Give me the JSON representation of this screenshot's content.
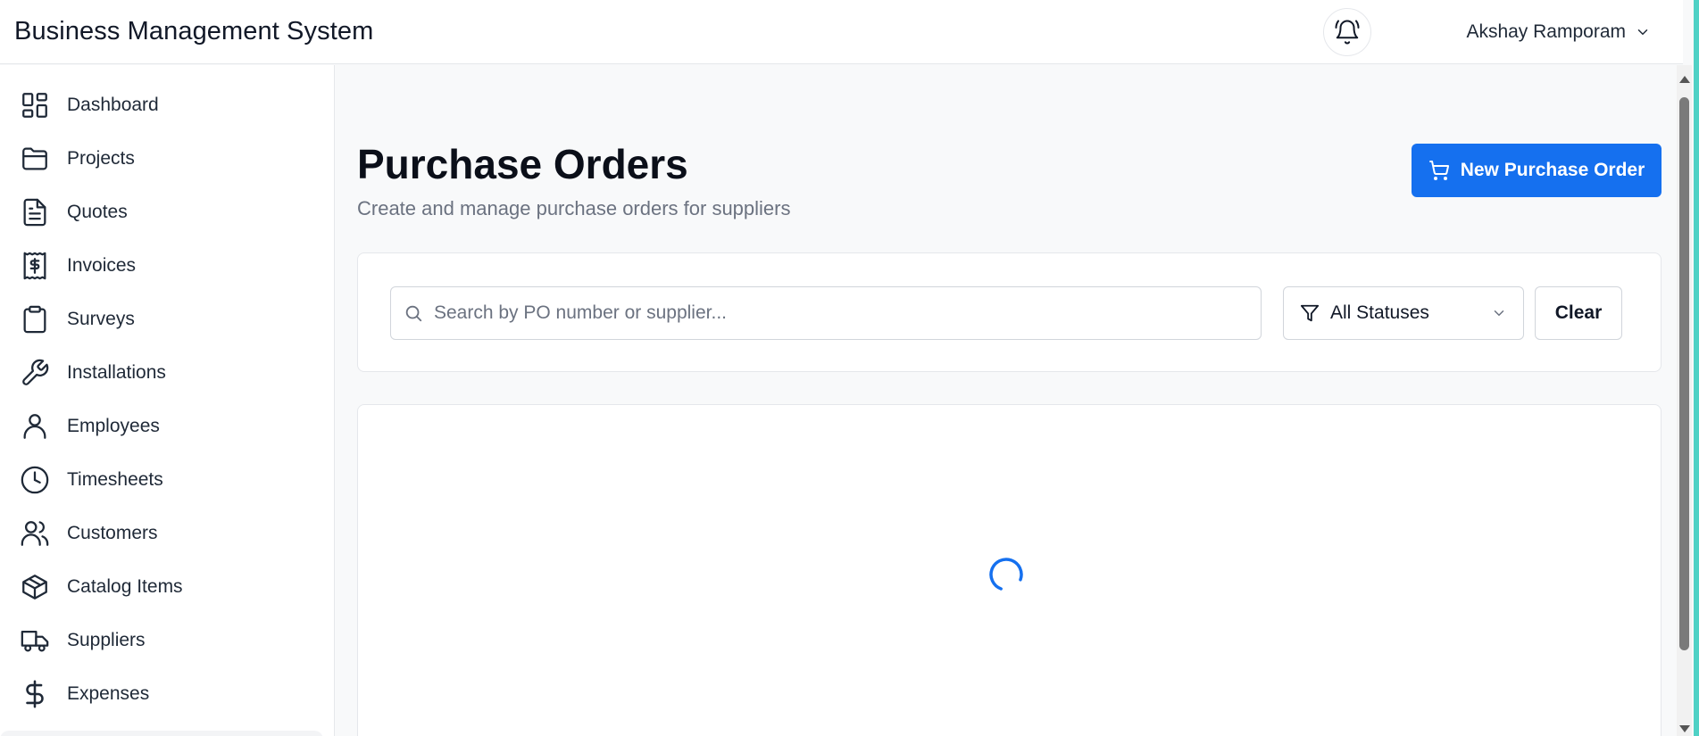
{
  "app": {
    "title": "Business Management System"
  },
  "header": {
    "user_name": "Akshay Ramporam",
    "bell_icon": "bell-ring-icon"
  },
  "sidebar": {
    "items": [
      {
        "label": "Dashboard",
        "icon": "dashboard-icon"
      },
      {
        "label": "Projects",
        "icon": "folder-icon"
      },
      {
        "label": "Quotes",
        "icon": "document-icon"
      },
      {
        "label": "Invoices",
        "icon": "receipt-icon"
      },
      {
        "label": "Surveys",
        "icon": "clipboard-icon"
      },
      {
        "label": "Installations",
        "icon": "wrench-icon"
      },
      {
        "label": "Employees",
        "icon": "user-icon"
      },
      {
        "label": "Timesheets",
        "icon": "clock-icon"
      },
      {
        "label": "Customers",
        "icon": "users-icon"
      },
      {
        "label": "Catalog Items",
        "icon": "package-icon"
      },
      {
        "label": "Suppliers",
        "icon": "truck-icon"
      },
      {
        "label": "Expenses",
        "icon": "dollar-icon"
      }
    ]
  },
  "page": {
    "title": "Purchase Orders",
    "subtitle": "Create and manage purchase orders for suppliers",
    "new_button_label": "New Purchase Order"
  },
  "filters": {
    "search_placeholder": "Search by PO number or supplier...",
    "search_value": "",
    "status_selected": "All Statuses",
    "clear_label": "Clear"
  },
  "results": {
    "loading": true
  },
  "colors": {
    "accent": "#1570ef",
    "sidebar_text": "#1f2937",
    "muted": "#6b7280",
    "edge_accent": "#4fd1c5"
  }
}
